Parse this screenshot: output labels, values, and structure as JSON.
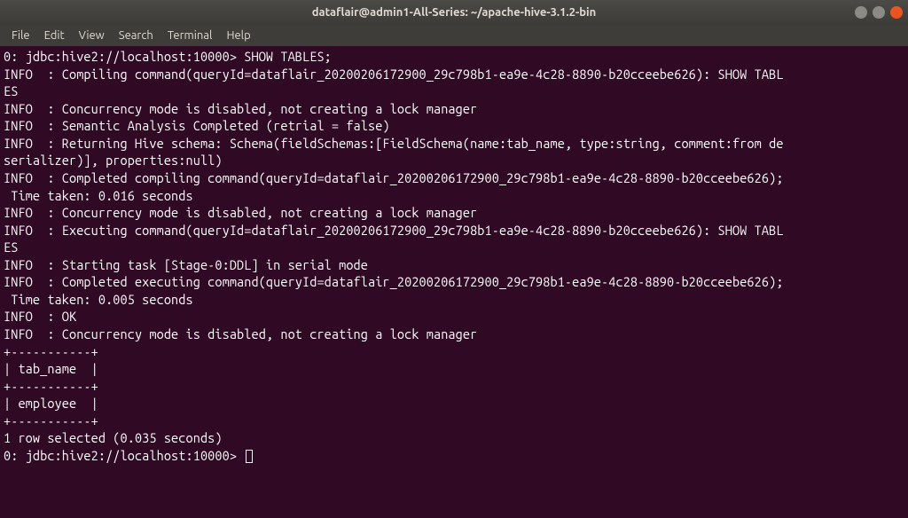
{
  "window": {
    "title": "dataflair@admin1-All-Series: ~/apache-hive-3.1.2-bin"
  },
  "menu": {
    "items": [
      "File",
      "Edit",
      "View",
      "Search",
      "Terminal",
      "Help"
    ]
  },
  "terminal": {
    "prompt": "0: jdbc:hive2://localhost:10000>",
    "command": "SHOW TABLES;",
    "lines": [
      "0: jdbc:hive2://localhost:10000> SHOW TABLES;",
      "INFO  : Compiling command(queryId=dataflair_20200206172900_29c798b1-ea9e-4c28-8890-b20cceebe626): SHOW TABL",
      "ES",
      "INFO  : Concurrency mode is disabled, not creating a lock manager",
      "INFO  : Semantic Analysis Completed (retrial = false)",
      "INFO  : Returning Hive schema: Schema(fieldSchemas:[FieldSchema(name:tab_name, type:string, comment:from de",
      "serializer)], properties:null)",
      "INFO  : Completed compiling command(queryId=dataflair_20200206172900_29c798b1-ea9e-4c28-8890-b20cceebe626);",
      " Time taken: 0.016 seconds",
      "INFO  : Concurrency mode is disabled, not creating a lock manager",
      "INFO  : Executing command(queryId=dataflair_20200206172900_29c798b1-ea9e-4c28-8890-b20cceebe626): SHOW TABL",
      "ES",
      "INFO  : Starting task [Stage-0:DDL] in serial mode",
      "INFO  : Completed executing command(queryId=dataflair_20200206172900_29c798b1-ea9e-4c28-8890-b20cceebe626);",
      " Time taken: 0.005 seconds",
      "INFO  : OK",
      "INFO  : Concurrency mode is disabled, not creating a lock manager",
      "+-----------+",
      "| tab_name  |",
      "+-----------+",
      "| employee  |",
      "+-----------+",
      "1 row selected (0.035 seconds)"
    ],
    "result_table": {
      "header": "tab_name",
      "rows": [
        "employee"
      ]
    },
    "summary": "1 row selected (0.035 seconds)",
    "final_prompt": "0: jdbc:hive2://localhost:10000> "
  }
}
